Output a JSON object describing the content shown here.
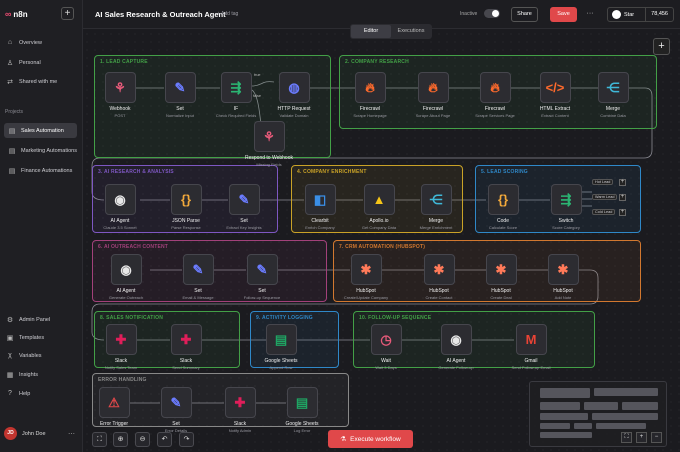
{
  "logo": {
    "mark": "∞",
    "text": "n8n"
  },
  "sidebar": {
    "top": [
      {
        "icon": "⌂",
        "label": "Overview"
      },
      {
        "icon": "♙",
        "label": "Personal"
      },
      {
        "icon": "⇄",
        "label": "Shared with me"
      }
    ],
    "projects_header": "Projects",
    "projects": [
      {
        "icon": "▤",
        "label": "Sales Automation",
        "active": true
      },
      {
        "icon": "▤",
        "label": "Marketing Automations"
      },
      {
        "icon": "▤",
        "label": "Finance Automations"
      }
    ],
    "bottom": [
      {
        "icon": "⚙",
        "label": "Admin Panel"
      },
      {
        "icon": "▣",
        "label": "Templates"
      },
      {
        "icon": "χ",
        "label": "Variables"
      },
      {
        "icon": "▦",
        "label": "Insights"
      },
      {
        "icon": "?",
        "label": "Help"
      }
    ],
    "user": {
      "initials": "JD",
      "name": "John Doe"
    }
  },
  "topbar": {
    "title": "AI Sales Research & Outreach Agent",
    "add_tag": "+ Add tag",
    "status": "Inactive",
    "share": "Share",
    "save": "Save",
    "more": "···",
    "star_label": "Star",
    "star_count": "78,456"
  },
  "tabs": {
    "editor": "Editor",
    "executions": "Executions"
  },
  "groups": {
    "lead_capture": {
      "label": "1. LEAD CAPTURE",
      "color": "#43a047"
    },
    "company_research": {
      "label": "2. COMPANY RESEARCH",
      "color": "#43a047"
    },
    "ai_research": {
      "label": "3. AI RESEARCH & ANALYSIS",
      "color": "#7e57c2"
    },
    "company_enrichment": {
      "label": "4. COMPANY ENRICHMENT",
      "color": "#c9a227"
    },
    "lead_scoring": {
      "label": "5. LEAD SCORING",
      "color": "#2f88c8"
    },
    "ai_outreach": {
      "label": "6. AI OUTREACH CONTENT",
      "color": "#a2417a"
    },
    "crm": {
      "label": "7. CRM AUTOMATION (HUBSPOT)",
      "color": "#d2782f"
    },
    "sales_notification": {
      "label": "8. SALES NOTIFICATION",
      "color": "#43a047"
    },
    "activity_logging": {
      "label": "9. ACTIVITY LOGGING",
      "color": "#2f88c8"
    },
    "follow_up": {
      "label": "10. FOLLOW-UP SEQUENCE",
      "color": "#43a047"
    },
    "error_handling": {
      "label": "ERROR HANDLING",
      "color": "#888888"
    }
  },
  "nodes": {
    "webhook": {
      "title": "Webhook",
      "sub": "POST",
      "icon": "⚘",
      "color": "#e85a7a"
    },
    "set1": {
      "title": "Set",
      "sub": "Normalize Input",
      "icon": "✎",
      "color": "#6b7cff"
    },
    "if1": {
      "title": "IF",
      "sub": "Check Required Fields",
      "icon": "⇶",
      "color": "#2bb673"
    },
    "http": {
      "title": "HTTP Request",
      "sub": "Validate Domain",
      "icon": "◍",
      "color": "#6b7cff"
    },
    "respond": {
      "title": "Respond to Webhook",
      "sub": "Missing Fields",
      "icon": "⚘",
      "color": "#e85a7a"
    },
    "fire1": {
      "title": "Firecrawl",
      "sub": "Scrape Homepage",
      "icon": "🔥︎",
      "color": "#ff6a2c"
    },
    "fire2": {
      "title": "Firecrawl",
      "sub": "Scrape About Page",
      "icon": "🔥︎",
      "color": "#ff6a2c"
    },
    "fire3": {
      "title": "Firecrawl",
      "sub": "Scrape Services Page",
      "icon": "🔥︎",
      "color": "#ff6a2c"
    },
    "html": {
      "title": "HTML Extract",
      "sub": "Extract Content",
      "icon": "</>",
      "color": "#ff6a2c"
    },
    "merge1": {
      "title": "Merge",
      "sub": "Combine Data",
      "icon": "⋲",
      "color": "#3fb8d8"
    },
    "aiagent1": {
      "title": "AI Agent",
      "sub": "Claude 3.5 Sonnet",
      "icon": "◉",
      "color": "#e8e8e8"
    },
    "jsonparse": {
      "title": "JSON Parse",
      "sub": "Parse Response",
      "icon": "{}",
      "color": "#f2a93b"
    },
    "set2": {
      "title": "Set",
      "sub": "Extract Key Insights",
      "icon": "✎",
      "color": "#6b7cff"
    },
    "clearbit": {
      "title": "Clearbit",
      "sub": "Enrich Company",
      "icon": "◧",
      "color": "#3a8ee6"
    },
    "apollo": {
      "title": "Apollo.io",
      "sub": "Get Company Data",
      "icon": "▲",
      "color": "#f5c518"
    },
    "merge2": {
      "title": "Merge",
      "sub": "Merge Enrichment",
      "icon": "⋲",
      "color": "#3fb8d8"
    },
    "code": {
      "title": "Code",
      "sub": "Calculate Score",
      "icon": "{}",
      "color": "#f2a93b"
    },
    "switch": {
      "title": "Switch",
      "sub": "Score Category",
      "icon": "⇶",
      "color": "#2bb673"
    },
    "aiagent2": {
      "title": "AI Agent",
      "sub": "Generate Outreach",
      "icon": "◉",
      "color": "#e8e8e8"
    },
    "set3": {
      "title": "Set",
      "sub": "Email & Message",
      "icon": "✎",
      "color": "#6b7cff"
    },
    "set4": {
      "title": "Set",
      "sub": "Follow-up Sequence",
      "icon": "✎",
      "color": "#6b7cff"
    },
    "hub1": {
      "title": "HubSpot",
      "sub": "Create/Update Company",
      "icon": "✱",
      "color": "#ff7a59"
    },
    "hub2": {
      "title": "HubSpot",
      "sub": "Create Contact",
      "icon": "✱",
      "color": "#ff7a59"
    },
    "hub3": {
      "title": "HubSpot",
      "sub": "Create Deal",
      "icon": "✱",
      "color": "#ff7a59"
    },
    "hub4": {
      "title": "HubSpot",
      "sub": "Add Note",
      "icon": "✱",
      "color": "#ff7a59"
    },
    "slack1": {
      "title": "Slack",
      "sub": "Notify Sales Team",
      "icon": "✚",
      "color": "#e01e5a"
    },
    "slack2": {
      "title": "Slack",
      "sub": "Send Summary",
      "icon": "✚",
      "color": "#e01e5a"
    },
    "sheets1": {
      "title": "Google Sheets",
      "sub": "Append Row",
      "icon": "▤",
      "color": "#1fa463"
    },
    "wait": {
      "title": "Wait",
      "sub": "Wait 3 Days",
      "icon": "◷",
      "color": "#e85a7a"
    },
    "aiagent3": {
      "title": "AI Agent",
      "sub": "Generate Follow-up",
      "icon": "◉",
      "color": "#e8e8e8"
    },
    "gmail": {
      "title": "Gmail",
      "sub": "Send Follow-up Email",
      "icon": "M",
      "color": "#ea4335"
    },
    "errortrigger": {
      "title": "Error Trigger",
      "sub": "",
      "icon": "⚠",
      "color": "#e0484a"
    },
    "set5": {
      "title": "Set",
      "sub": "Error Details",
      "icon": "✎",
      "color": "#6b7cff"
    },
    "slack3": {
      "title": "Slack",
      "sub": "Notify Admin",
      "icon": "✚",
      "color": "#e01e5a"
    },
    "sheets2": {
      "title": "Google Sheets",
      "sub": "Log Error",
      "icon": "▤",
      "color": "#1fa463"
    }
  },
  "branches": {
    "true": "true",
    "false": "false"
  },
  "switch_outputs": [
    "Hot Lead",
    "Warm Lead",
    "Cold Lead"
  ],
  "execute": {
    "icon": "⚗",
    "label": "Execute workflow"
  },
  "controls": [
    "⛶",
    "⊕",
    "⊖",
    "↶",
    "↷"
  ]
}
